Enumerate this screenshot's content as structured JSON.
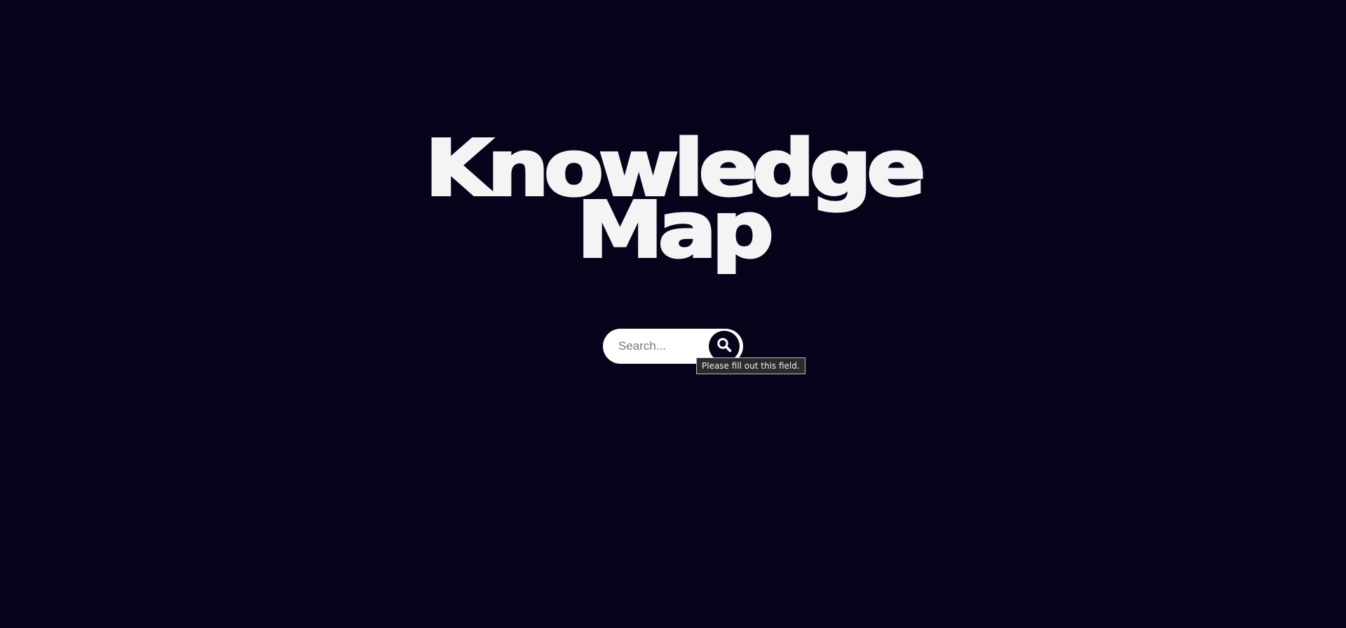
{
  "hero": {
    "title_line1": "Knowledge",
    "title_line2": "Map"
  },
  "search": {
    "placeholder": "Search...",
    "value": "",
    "button_icon": "search-icon"
  },
  "validation": {
    "tooltip": "Please fill out this field."
  },
  "colors": {
    "background": "#05041a",
    "title": "#f4f4f4",
    "search_field": "#ffffff",
    "search_button": "#05041a"
  }
}
